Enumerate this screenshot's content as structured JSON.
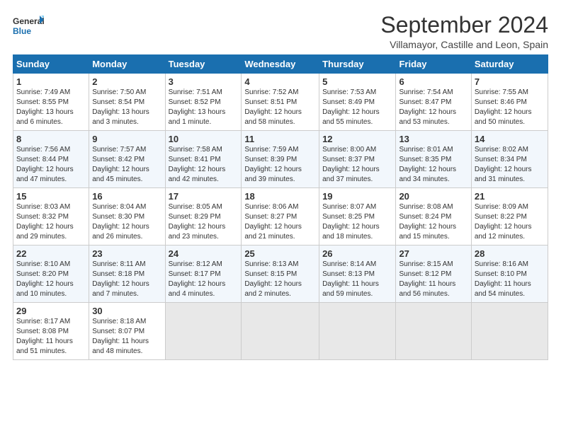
{
  "header": {
    "logo_line1": "General",
    "logo_line2": "Blue",
    "title": "September 2024",
    "subtitle": "Villamayor, Castille and Leon, Spain"
  },
  "weekdays": [
    "Sunday",
    "Monday",
    "Tuesday",
    "Wednesday",
    "Thursday",
    "Friday",
    "Saturday"
  ],
  "weeks": [
    [
      {
        "day": "1",
        "info": "Sunrise: 7:49 AM\nSunset: 8:55 PM\nDaylight: 13 hours\nand 6 minutes."
      },
      {
        "day": "2",
        "info": "Sunrise: 7:50 AM\nSunset: 8:54 PM\nDaylight: 13 hours\nand 3 minutes."
      },
      {
        "day": "3",
        "info": "Sunrise: 7:51 AM\nSunset: 8:52 PM\nDaylight: 13 hours\nand 1 minute."
      },
      {
        "day": "4",
        "info": "Sunrise: 7:52 AM\nSunset: 8:51 PM\nDaylight: 12 hours\nand 58 minutes."
      },
      {
        "day": "5",
        "info": "Sunrise: 7:53 AM\nSunset: 8:49 PM\nDaylight: 12 hours\nand 55 minutes."
      },
      {
        "day": "6",
        "info": "Sunrise: 7:54 AM\nSunset: 8:47 PM\nDaylight: 12 hours\nand 53 minutes."
      },
      {
        "day": "7",
        "info": "Sunrise: 7:55 AM\nSunset: 8:46 PM\nDaylight: 12 hours\nand 50 minutes."
      }
    ],
    [
      {
        "day": "8",
        "info": "Sunrise: 7:56 AM\nSunset: 8:44 PM\nDaylight: 12 hours\nand 47 minutes."
      },
      {
        "day": "9",
        "info": "Sunrise: 7:57 AM\nSunset: 8:42 PM\nDaylight: 12 hours\nand 45 minutes."
      },
      {
        "day": "10",
        "info": "Sunrise: 7:58 AM\nSunset: 8:41 PM\nDaylight: 12 hours\nand 42 minutes."
      },
      {
        "day": "11",
        "info": "Sunrise: 7:59 AM\nSunset: 8:39 PM\nDaylight: 12 hours\nand 39 minutes."
      },
      {
        "day": "12",
        "info": "Sunrise: 8:00 AM\nSunset: 8:37 PM\nDaylight: 12 hours\nand 37 minutes."
      },
      {
        "day": "13",
        "info": "Sunrise: 8:01 AM\nSunset: 8:35 PM\nDaylight: 12 hours\nand 34 minutes."
      },
      {
        "day": "14",
        "info": "Sunrise: 8:02 AM\nSunset: 8:34 PM\nDaylight: 12 hours\nand 31 minutes."
      }
    ],
    [
      {
        "day": "15",
        "info": "Sunrise: 8:03 AM\nSunset: 8:32 PM\nDaylight: 12 hours\nand 29 minutes."
      },
      {
        "day": "16",
        "info": "Sunrise: 8:04 AM\nSunset: 8:30 PM\nDaylight: 12 hours\nand 26 minutes."
      },
      {
        "day": "17",
        "info": "Sunrise: 8:05 AM\nSunset: 8:29 PM\nDaylight: 12 hours\nand 23 minutes."
      },
      {
        "day": "18",
        "info": "Sunrise: 8:06 AM\nSunset: 8:27 PM\nDaylight: 12 hours\nand 21 minutes."
      },
      {
        "day": "19",
        "info": "Sunrise: 8:07 AM\nSunset: 8:25 PM\nDaylight: 12 hours\nand 18 minutes."
      },
      {
        "day": "20",
        "info": "Sunrise: 8:08 AM\nSunset: 8:24 PM\nDaylight: 12 hours\nand 15 minutes."
      },
      {
        "day": "21",
        "info": "Sunrise: 8:09 AM\nSunset: 8:22 PM\nDaylight: 12 hours\nand 12 minutes."
      }
    ],
    [
      {
        "day": "22",
        "info": "Sunrise: 8:10 AM\nSunset: 8:20 PM\nDaylight: 12 hours\nand 10 minutes."
      },
      {
        "day": "23",
        "info": "Sunrise: 8:11 AM\nSunset: 8:18 PM\nDaylight: 12 hours\nand 7 minutes."
      },
      {
        "day": "24",
        "info": "Sunrise: 8:12 AM\nSunset: 8:17 PM\nDaylight: 12 hours\nand 4 minutes."
      },
      {
        "day": "25",
        "info": "Sunrise: 8:13 AM\nSunset: 8:15 PM\nDaylight: 12 hours\nand 2 minutes."
      },
      {
        "day": "26",
        "info": "Sunrise: 8:14 AM\nSunset: 8:13 PM\nDaylight: 11 hours\nand 59 minutes."
      },
      {
        "day": "27",
        "info": "Sunrise: 8:15 AM\nSunset: 8:12 PM\nDaylight: 11 hours\nand 56 minutes."
      },
      {
        "day": "28",
        "info": "Sunrise: 8:16 AM\nSunset: 8:10 PM\nDaylight: 11 hours\nand 54 minutes."
      }
    ],
    [
      {
        "day": "29",
        "info": "Sunrise: 8:17 AM\nSunset: 8:08 PM\nDaylight: 11 hours\nand 51 minutes."
      },
      {
        "day": "30",
        "info": "Sunrise: 8:18 AM\nSunset: 8:07 PM\nDaylight: 11 hours\nand 48 minutes."
      },
      {
        "day": "",
        "info": ""
      },
      {
        "day": "",
        "info": ""
      },
      {
        "day": "",
        "info": ""
      },
      {
        "day": "",
        "info": ""
      },
      {
        "day": "",
        "info": ""
      }
    ]
  ]
}
